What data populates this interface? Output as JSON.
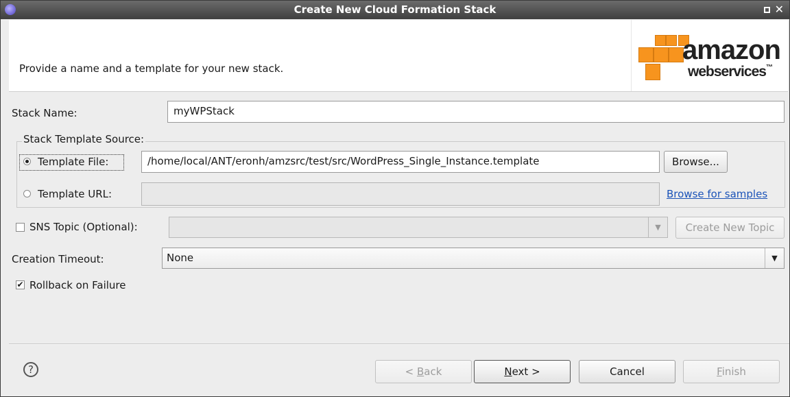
{
  "window": {
    "title": "Create New Cloud Formation Stack"
  },
  "header": {
    "description": "Provide a name and a template for your new stack.",
    "logo_line1": "amazon",
    "logo_line2": "webservices",
    "logo_tm": "™"
  },
  "form": {
    "stack_name_label": "Stack Name:",
    "stack_name_value": "myWPStack",
    "template_source_label": "Stack Template Source:",
    "template_file_label": "Template File:",
    "template_file_value": "/home/local/ANT/eronh/amzsrc/test/src/WordPress_Single_Instance.template",
    "browse_label": "Browse...",
    "template_url_label": "Template URL:",
    "template_url_value": "",
    "browse_samples_label": "Browse for samples",
    "sns_label": "SNS Topic (Optional):",
    "sns_value": "",
    "create_topic_label": "Create New Topic",
    "timeout_label": "Creation Timeout:",
    "timeout_value": "None",
    "rollback_label": "Rollback on Failure",
    "rollback_checked": true
  },
  "footer": {
    "back_prefix": "< ",
    "back_key": "B",
    "back_rest": "ack",
    "next_key": "N",
    "next_rest": "ext >",
    "cancel_label": "Cancel",
    "finish_key": "F",
    "finish_rest": "inish"
  },
  "colors": {
    "accent_link": "#1b53b8",
    "aws_orange": "#f7941e"
  }
}
